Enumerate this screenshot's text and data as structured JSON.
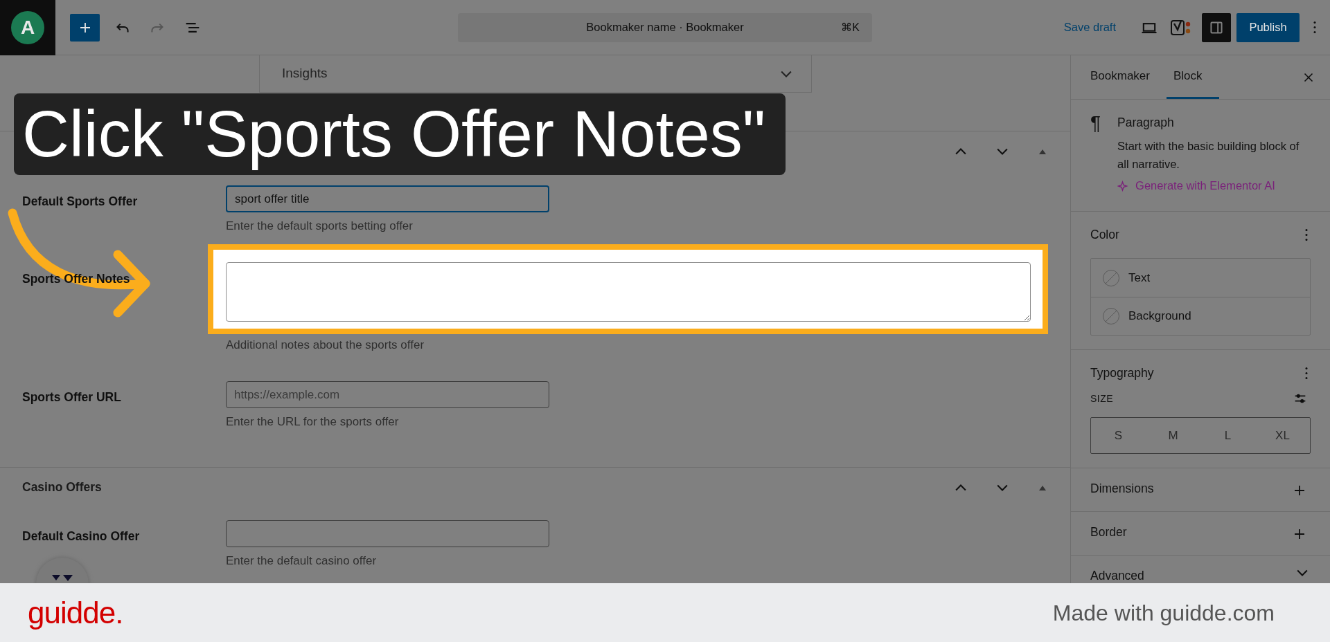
{
  "toolbar": {
    "logo": "A",
    "title": "Bookmaker name · Bookmaker",
    "shortcut": "⌘K",
    "save_draft": "Save draft",
    "publish": "Publish"
  },
  "insights": {
    "label": "Insights"
  },
  "instruction": "Click \"Sports Offer Notes\"",
  "sections": [
    {
      "fields": [
        {
          "label": "Default Sports Offer",
          "kind": "input",
          "value": "sport offer title",
          "focused": true,
          "help": "Enter the default sports betting offer"
        },
        {
          "label": "Sports Offer Notes",
          "kind": "textarea",
          "highlighted": true,
          "help": "Additional notes about the sports offer"
        },
        {
          "label": "Sports Offer URL",
          "kind": "input",
          "placeholder": "https://example.com",
          "help": "Enter the URL for the sports offer"
        }
      ]
    },
    {
      "title": "Casino Offers",
      "fields": [
        {
          "label": "Default Casino Offer",
          "kind": "input",
          "help": "Enter the default casino offer"
        }
      ]
    }
  ],
  "sidebar": {
    "tabs": [
      {
        "label": "Bookmaker",
        "selected": false
      },
      {
        "label": "Block",
        "selected": true
      }
    ],
    "block": {
      "icon": "¶",
      "name": "Paragraph",
      "description": "Start with the basic building block of all narrative.",
      "ai_link": "Generate with Elementor AI"
    },
    "color": {
      "title": "Color",
      "items": [
        "Text",
        "Background"
      ]
    },
    "typography": {
      "title": "Typography",
      "size_label": "SIZE",
      "sizes": [
        "S",
        "M",
        "L",
        "XL"
      ]
    },
    "panels": [
      {
        "title": "Dimensions",
        "kind": "add"
      },
      {
        "title": "Border",
        "kind": "add"
      },
      {
        "title": "Advanced",
        "kind": "expand"
      }
    ]
  },
  "footer": {
    "brand": "guidde.",
    "credit": "Made with guidde.com"
  }
}
